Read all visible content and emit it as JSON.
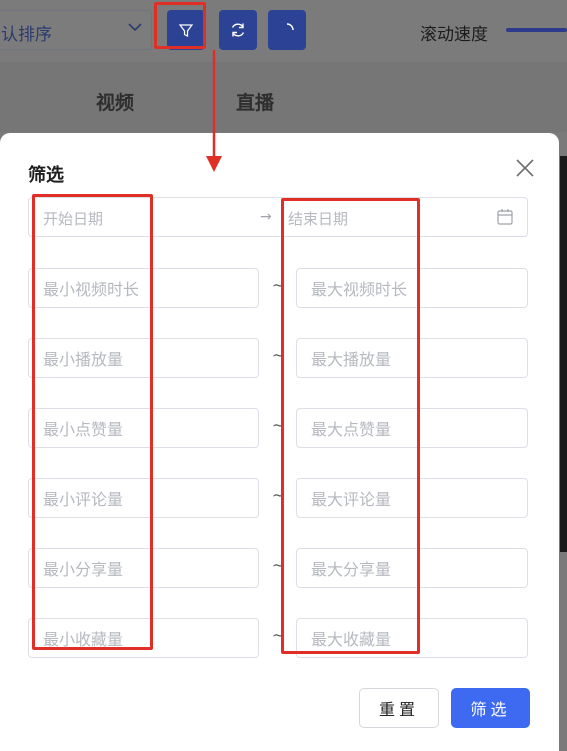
{
  "toolbar": {
    "sort_label": "认排序",
    "speed_label": "滚动速度"
  },
  "tabs": [
    "视频",
    "直播"
  ],
  "dialog": {
    "title": "筛选",
    "date_start_placeholder": "开始日期",
    "date_end_placeholder": "结束日期",
    "date_separator": "→",
    "ranges": [
      {
        "min_placeholder": "最小视频时长",
        "max_placeholder": "最大视频时长"
      },
      {
        "min_placeholder": "最小播放量",
        "max_placeholder": "最大播放量"
      },
      {
        "min_placeholder": "最小点赞量",
        "max_placeholder": "最大点赞量"
      },
      {
        "min_placeholder": "最小评论量",
        "max_placeholder": "最大评论量"
      },
      {
        "min_placeholder": "最小分享量",
        "max_placeholder": "最大分享量"
      },
      {
        "min_placeholder": "最小收藏量",
        "max_placeholder": "最大收藏量"
      }
    ],
    "range_separator": "~",
    "reset_label": "重置",
    "submit_label": "筛选"
  },
  "colors": {
    "primary": "#3d6af0",
    "annotation": "#e02f26",
    "toolbar_button": "#2c4395"
  },
  "icons": [
    "chevron-down-icon",
    "filter-icon",
    "refresh-icon",
    "loading-icon",
    "close-icon",
    "calendar-icon",
    "arrow-right-icon"
  ]
}
